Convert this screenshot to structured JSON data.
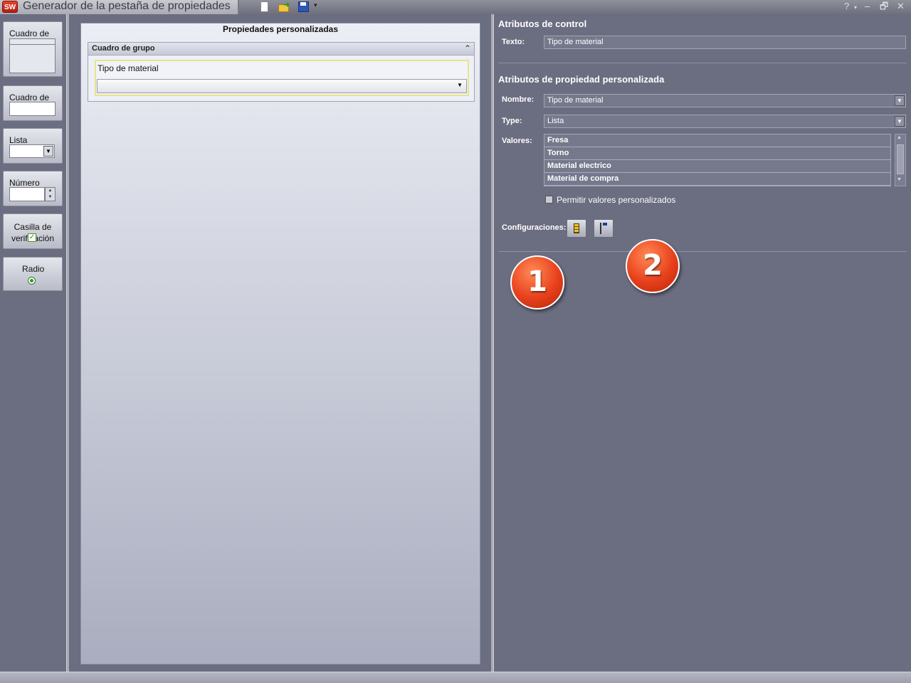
{
  "window": {
    "title": "Generador de la pestaña de propiedades",
    "logo_text": "SW",
    "help_symbol": "?",
    "dropdown_symbol": "▾",
    "minimize_symbol": "–",
    "restore_symbol": "🗗",
    "close_symbol": "✕"
  },
  "toolbar": {
    "icons": [
      "new-document-icon",
      "open-folder-icon",
      "save-icon"
    ]
  },
  "toolbox": {
    "group_box_label": "Cuadro de",
    "text_box_label": "Cuadro de",
    "list_label": "Lista",
    "list_arrow": "▼",
    "number_label": "Número",
    "number_spin": "▲▼",
    "checkbox_label": "Casilla de verificación",
    "checkbox_mark": "✓",
    "radio_label": "Radio"
  },
  "preview": {
    "title": "Propiedades personalizadas",
    "group_box_title": "Cuadro de grupo",
    "collapse_symbol": "⌃",
    "field_label": "Tipo de material",
    "combo_arrow": "▼"
  },
  "attributes": {
    "control_title": "Atributos de control",
    "text_label": "Texto:",
    "text_value": "Tipo de material",
    "custom_title": "Atributos de propiedad personalizada",
    "name_label": "Nombre:",
    "name_value": "Tipo de material",
    "type_label": "Type:",
    "type_value": "Lista",
    "values_label": "Valores:",
    "values": [
      "Fresa",
      "Torno",
      "Material electrico",
      "Material de compra"
    ],
    "allow_custom_label": "Permitir valores personalizados",
    "allow_custom_checked": false,
    "configs_label": "Configuraciones:",
    "combo_arrow": "▼",
    "scroll_up": "▲",
    "scroll_down": "▼"
  },
  "badges": {
    "first": "1",
    "second": "2"
  },
  "colors": {
    "background": "#6b6d80",
    "badge": "#e8401c",
    "field_highlight": "#e7e48c"
  }
}
